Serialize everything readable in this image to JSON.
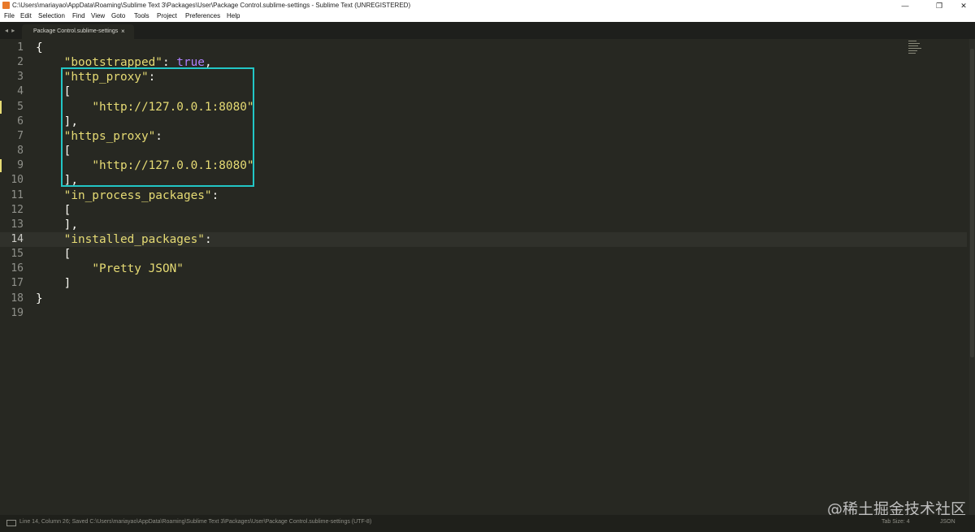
{
  "window": {
    "title": "C:\\Users\\mariayao\\AppData\\Roaming\\Sublime Text 3\\Packages\\User\\Package Control.sublime-settings - Sublime Text (UNREGISTERED)",
    "minimize": "—",
    "restore": "❐",
    "close": "✕"
  },
  "menu": {
    "items": [
      "File",
      "Edit",
      "Selection",
      "Find",
      "View",
      "Goto",
      "Tools",
      "Project",
      "Preferences",
      "Help"
    ]
  },
  "tabs": {
    "nav": "◂ ▸",
    "active_tab": "Package Control.sublime-settings",
    "close": "×"
  },
  "editor": {
    "line_numbers": [
      "1",
      "2",
      "3",
      "4",
      "5",
      "6",
      "7",
      "8",
      "9",
      "10",
      "11",
      "12",
      "13",
      "14",
      "15",
      "16",
      "17",
      "18",
      "19"
    ],
    "active_line": 14,
    "modified_lines": [
      5,
      9
    ],
    "highlighted_lines": [
      3,
      10
    ],
    "code_lines": [
      [
        {
          "t": "{",
          "c": "p"
        }
      ],
      [
        {
          "t": "    ",
          "c": "p"
        },
        {
          "t": "\"bootstrapped\"",
          "c": "s"
        },
        {
          "t": ": ",
          "c": "p"
        },
        {
          "t": "true",
          "c": "k"
        },
        {
          "t": ",",
          "c": "p"
        }
      ],
      [
        {
          "t": "    ",
          "c": "p"
        },
        {
          "t": "\"http_proxy\"",
          "c": "s"
        },
        {
          "t": ":",
          "c": "p"
        }
      ],
      [
        {
          "t": "    [",
          "c": "p"
        }
      ],
      [
        {
          "t": "        ",
          "c": "p"
        },
        {
          "t": "\"http://127.0.0.1:8080\"",
          "c": "s"
        }
      ],
      [
        {
          "t": "    ],",
          "c": "p"
        }
      ],
      [
        {
          "t": "    ",
          "c": "p"
        },
        {
          "t": "\"https_proxy\"",
          "c": "s"
        },
        {
          "t": ":",
          "c": "p"
        }
      ],
      [
        {
          "t": "    [",
          "c": "p"
        }
      ],
      [
        {
          "t": "        ",
          "c": "p"
        },
        {
          "t": "\"http://127.0.0.1:8080\"",
          "c": "s"
        }
      ],
      [
        {
          "t": "    ],",
          "c": "p"
        }
      ],
      [
        {
          "t": "    ",
          "c": "p"
        },
        {
          "t": "\"in_process_packages\"",
          "c": "s"
        },
        {
          "t": ":",
          "c": "p"
        }
      ],
      [
        {
          "t": "    [",
          "c": "p"
        }
      ],
      [
        {
          "t": "    ],",
          "c": "p"
        }
      ],
      [
        {
          "t": "    ",
          "c": "p"
        },
        {
          "t": "\"installed_packages\"",
          "c": "s"
        },
        {
          "t": ":",
          "c": "p"
        }
      ],
      [
        {
          "t": "    [",
          "c": "p"
        }
      ],
      [
        {
          "t": "        ",
          "c": "p"
        },
        {
          "t": "\"Pretty JSON\"",
          "c": "s"
        }
      ],
      [
        {
          "t": "    ]",
          "c": "p"
        }
      ],
      [
        {
          "t": "}",
          "c": "p"
        }
      ],
      []
    ]
  },
  "watermark": "@稀土掘金技术社区",
  "status": {
    "text": "Line 14, Column 26; Saved C:\\Users\\mariayao\\AppData\\Roaming\\Sublime Text 3\\Packages\\User\\Package Control.sublime-settings (UTF-8)",
    "tab_size": "Tab Size: 4",
    "syntax": "JSON"
  },
  "colors": {
    "background": "#272822",
    "string": "#e6db74",
    "keyword": "#ae81ff",
    "highlight_box": "#22c6c6",
    "gutter": "#8f908a"
  }
}
